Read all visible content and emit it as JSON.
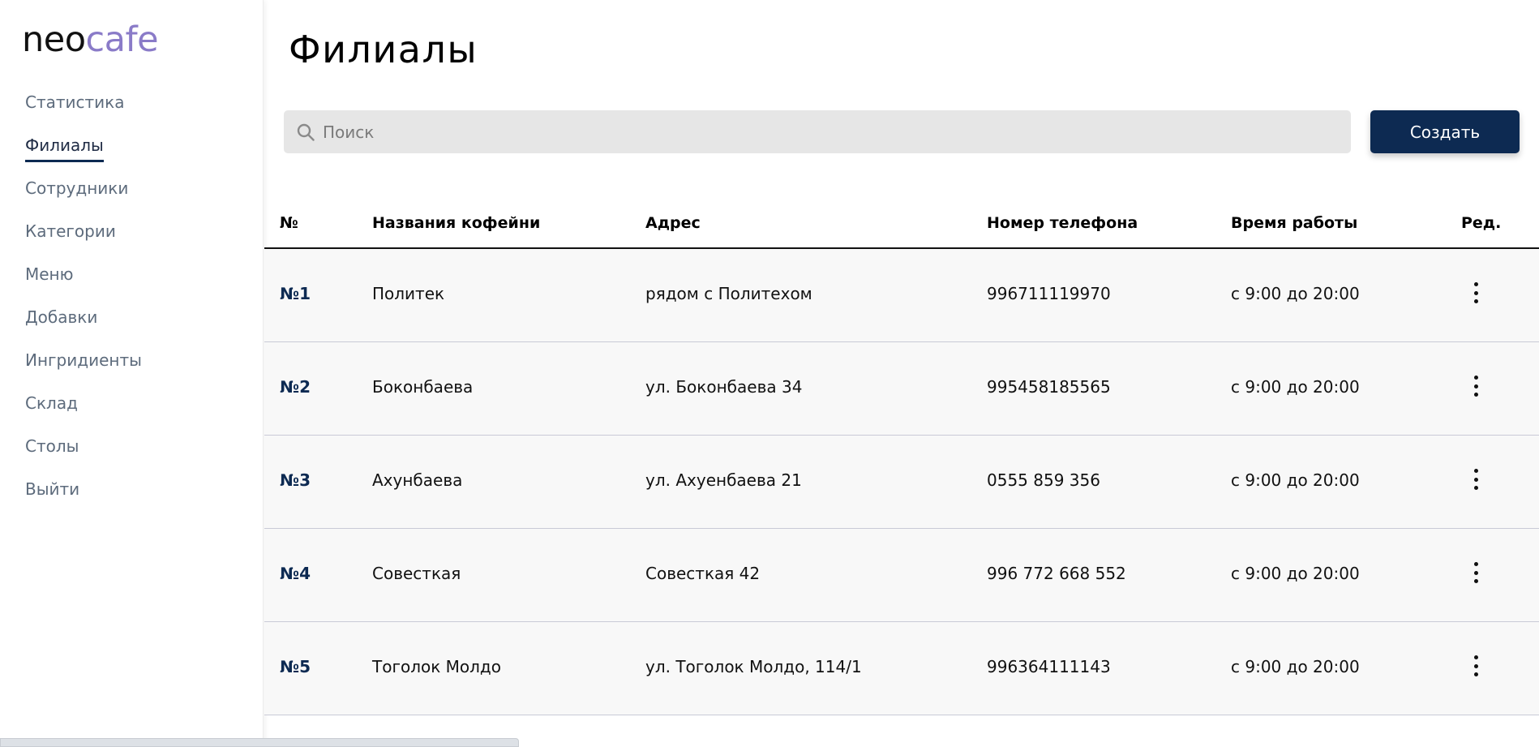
{
  "logo": {
    "part1": "neo",
    "part2": "cafe"
  },
  "sidebar": {
    "items": [
      {
        "label": "Статистика"
      },
      {
        "label": "Филиалы",
        "active": true
      },
      {
        "label": "Сотрудники"
      },
      {
        "label": "Категории"
      },
      {
        "label": "Меню"
      },
      {
        "label": "Добавки"
      },
      {
        "label": "Ингридиенты"
      },
      {
        "label": "Склад"
      },
      {
        "label": "Столы"
      },
      {
        "label": "Выйти"
      }
    ]
  },
  "page": {
    "title": "Филиалы"
  },
  "search": {
    "placeholder": "Поиск",
    "icon": "search-icon"
  },
  "toolbar": {
    "create_label": "Создать"
  },
  "table": {
    "headers": [
      "№",
      "Названия кофейни",
      "Адрес",
      "Номер телефона",
      "Время работы",
      "Ред."
    ],
    "rows": [
      {
        "num": "№1",
        "name": "Политек",
        "address": "рядом с Политехом",
        "phone": "996711119970",
        "hours": "с 9:00 до 20:00"
      },
      {
        "num": "№2",
        "name": "Боконбаева",
        "address": "ул. Боконбаева 34",
        "phone": "995458185565",
        "hours": "с 9:00 до 20:00"
      },
      {
        "num": "№3",
        "name": "Ахунбаева",
        "address": "ул. Ахуенбаева 21",
        "phone": "0555 859 356",
        "hours": "с 9:00 до 20:00"
      },
      {
        "num": "№4",
        "name": "Совесткая",
        "address": "Совесткая 42",
        "phone": "996 772 668 552",
        "hours": "с 9:00 до 20:00"
      },
      {
        "num": "№5",
        "name": "Тоголок Молдо",
        "address": "ул. Тоголок Молдо, 114/1",
        "phone": "996364111143",
        "hours": "с 9:00 до 20:00"
      }
    ]
  },
  "colors": {
    "primary": "#0d2a52",
    "logo_accent": "#8a7bc8",
    "nav_text": "#5d6b7c",
    "search_bg": "#e6e6e6"
  }
}
